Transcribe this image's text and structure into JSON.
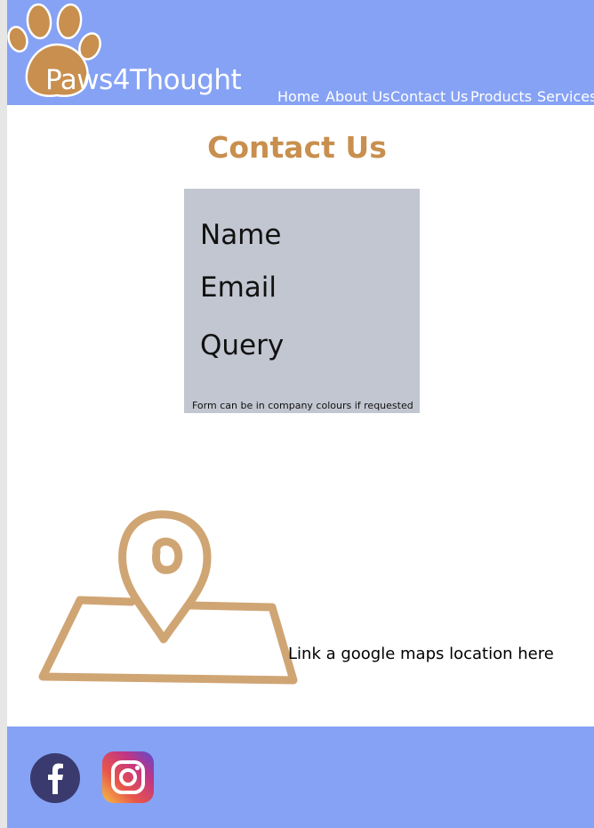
{
  "header": {
    "brand": "Paws4Thought",
    "logo_icon": "paw-print-icon",
    "background": "#86a2f5",
    "nav": [
      "Home",
      "About Us",
      "Contact Us",
      "Products",
      "Services"
    ]
  },
  "main": {
    "title": "Contact Us",
    "title_color": "#c88f4e",
    "form": {
      "fields": [
        "Name",
        "Email",
        "Query"
      ],
      "note": "Form can be in company colours if requested",
      "background": "#c2c6d0"
    },
    "map": {
      "icon": "map-pin-icon",
      "text": "Link a google maps location here",
      "color": "#d0a574"
    }
  },
  "footer": {
    "background": "#86a2f5",
    "social": [
      {
        "icon": "facebook-icon",
        "color": "#3a3a6e"
      },
      {
        "icon": "instagram-icon"
      }
    ]
  }
}
